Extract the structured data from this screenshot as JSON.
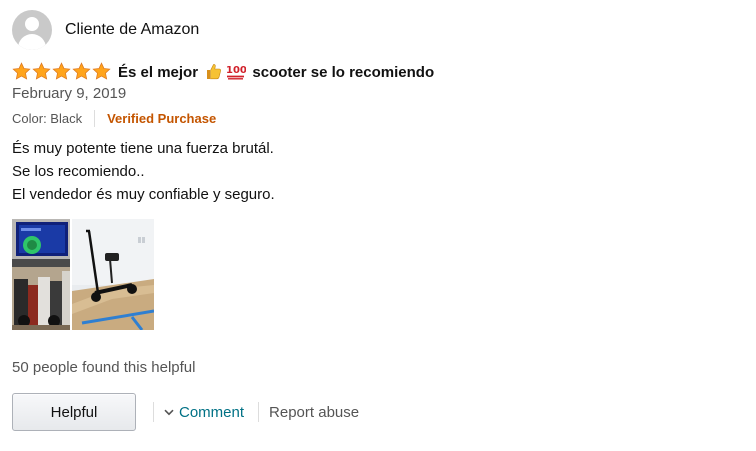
{
  "review": {
    "profile_name": "Cliente de Amazon",
    "rating": 5,
    "rating_max": 5,
    "title_part1": "És el mejor",
    "title_part2": "scooter se lo recomiendo",
    "title_emojis": [
      "thumbs-up-icon",
      "hundred-points-icon"
    ],
    "date": "February 9, 2019",
    "variant": "Color: Black",
    "verified": "Verified Purchase",
    "body_lines": [
      "És muy potente tiene una fuerza brutál.",
      "Se los recomiendo..",
      "El vendedor és muy confiable y seguro."
    ],
    "photos": [
      "scooter-photo-1",
      "scooter-photo-2"
    ],
    "helpful_count_text": "50 people found this helpful",
    "helpful_button": "Helpful",
    "comment_link": "Comment",
    "report_link": "Report abuse"
  },
  "colors": {
    "star": "#ffa41c",
    "verified": "#c45500",
    "link": "#007185",
    "secondary_text": "#555555"
  }
}
